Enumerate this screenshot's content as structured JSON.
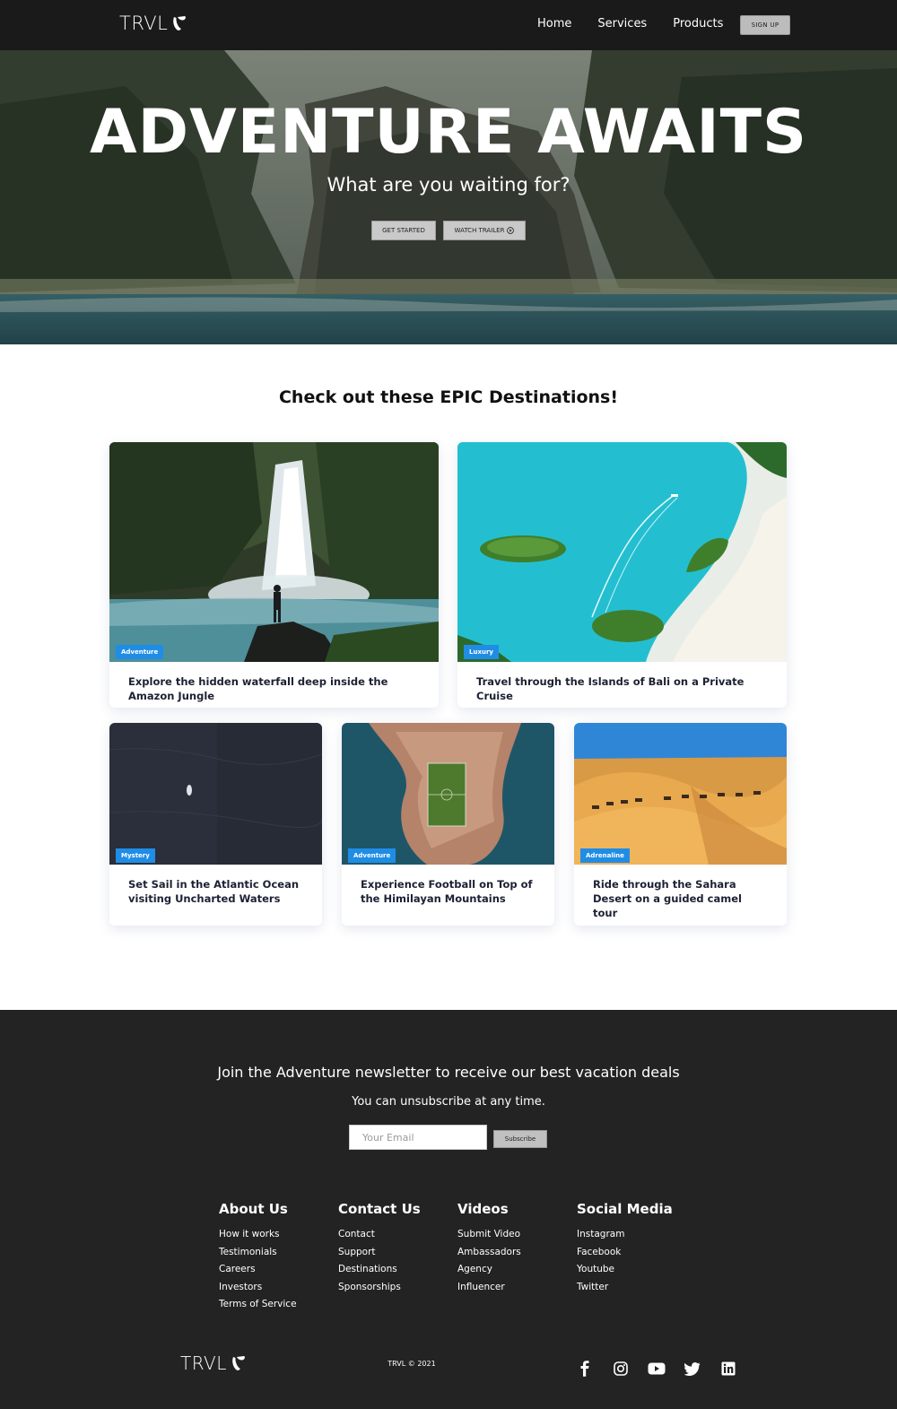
{
  "nav": {
    "logo": "TRVL",
    "links": [
      "Home",
      "Services",
      "Products"
    ],
    "signup_label": "SIGN UP"
  },
  "hero": {
    "title": "ADVENTURE AWAITS",
    "subtitle": "What are you waiting for?",
    "get_started_label": "GET STARTED",
    "watch_trailer_label": "WATCH TRAILER"
  },
  "destinations": {
    "title": "Check out these EPIC Destinations!",
    "cards": [
      {
        "tag": "Adventure",
        "text": "Explore the hidden waterfall deep inside the Amazon Jungle"
      },
      {
        "tag": "Luxury",
        "text": "Travel through the Islands of Bali on a Private Cruise"
      },
      {
        "tag": "Mystery",
        "text": "Set Sail in the Atlantic Ocean visiting Uncharted Waters"
      },
      {
        "tag": "Adventure",
        "text": "Experience Football on Top of the Himilayan Mountains"
      },
      {
        "tag": "Adrenaline",
        "text": "Ride through the Sahara Desert on a guided camel tour"
      }
    ]
  },
  "newsletter": {
    "title": "Join the Adventure newsletter to receive our best vacation deals",
    "subtitle": "You can unsubscribe at any time.",
    "email_placeholder": "Your Email",
    "subscribe_label": "Subscribe"
  },
  "footer": {
    "columns": [
      {
        "heading": "About Us",
        "links": [
          "How it works",
          "Testimonials",
          "Careers",
          "Investors",
          "Terms of Service"
        ]
      },
      {
        "heading": "Contact Us",
        "links": [
          "Contact",
          "Support",
          "Destinations",
          "Sponsorships"
        ]
      },
      {
        "heading": "Videos",
        "links": [
          "Submit Video",
          "Ambassadors",
          "Agency",
          "Influencer"
        ]
      },
      {
        "heading": "Social Media",
        "links": [
          "Instagram",
          "Facebook",
          "Youtube",
          "Twitter"
        ]
      }
    ],
    "logo": "TRVL",
    "copyright": "TRVL © 2021",
    "social_icons": [
      "facebook-icon",
      "instagram-icon",
      "youtube-icon",
      "twitter-icon",
      "linkedin-icon"
    ]
  },
  "colors": {
    "nav_bg": "#1a1a1a",
    "footer_bg": "#232323",
    "tag_blue": "#1f8de6"
  }
}
